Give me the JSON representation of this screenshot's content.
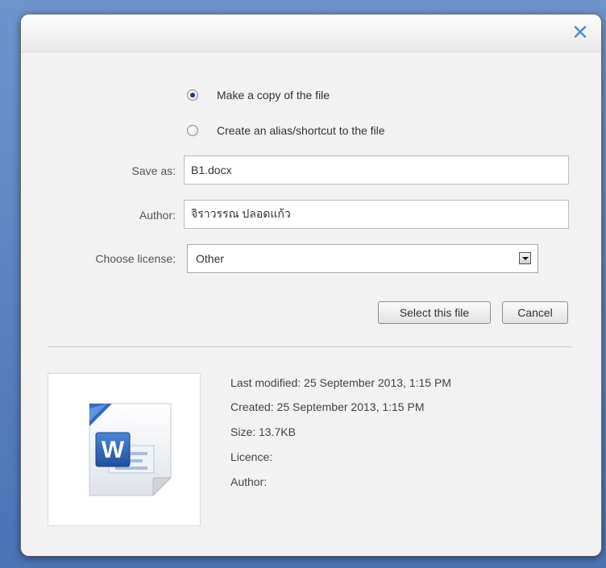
{
  "dialog": {
    "close_icon": "close-icon",
    "close_glyph": "✕"
  },
  "options": {
    "copy_label": "Make a copy of the file",
    "copy_checked": true,
    "alias_label": "Create an alias/shortcut to the file",
    "alias_checked": false
  },
  "form": {
    "save_as_label": "Save as:",
    "save_as_value": "B1.docx",
    "author_label": "Author:",
    "author_value": "จิราวรรณ ปลอดแก้ว",
    "license_label": "Choose license:",
    "license_value": "Other"
  },
  "buttons": {
    "select_label": "Select this file",
    "cancel_label": "Cancel"
  },
  "file_info": {
    "last_modified": "Last modified: 25 September 2013, 1:15 PM",
    "created": "Created: 25 September 2013, 1:15 PM",
    "size": "Size: 13.7KB",
    "licence": "Licence:",
    "author": "Author:",
    "icon": "word-document-icon",
    "icon_letter": "W"
  },
  "colors": {
    "accent": "#4f8fd6",
    "word_blue": "#2b5aa8",
    "dialog_bg": "#f2f2f2"
  }
}
